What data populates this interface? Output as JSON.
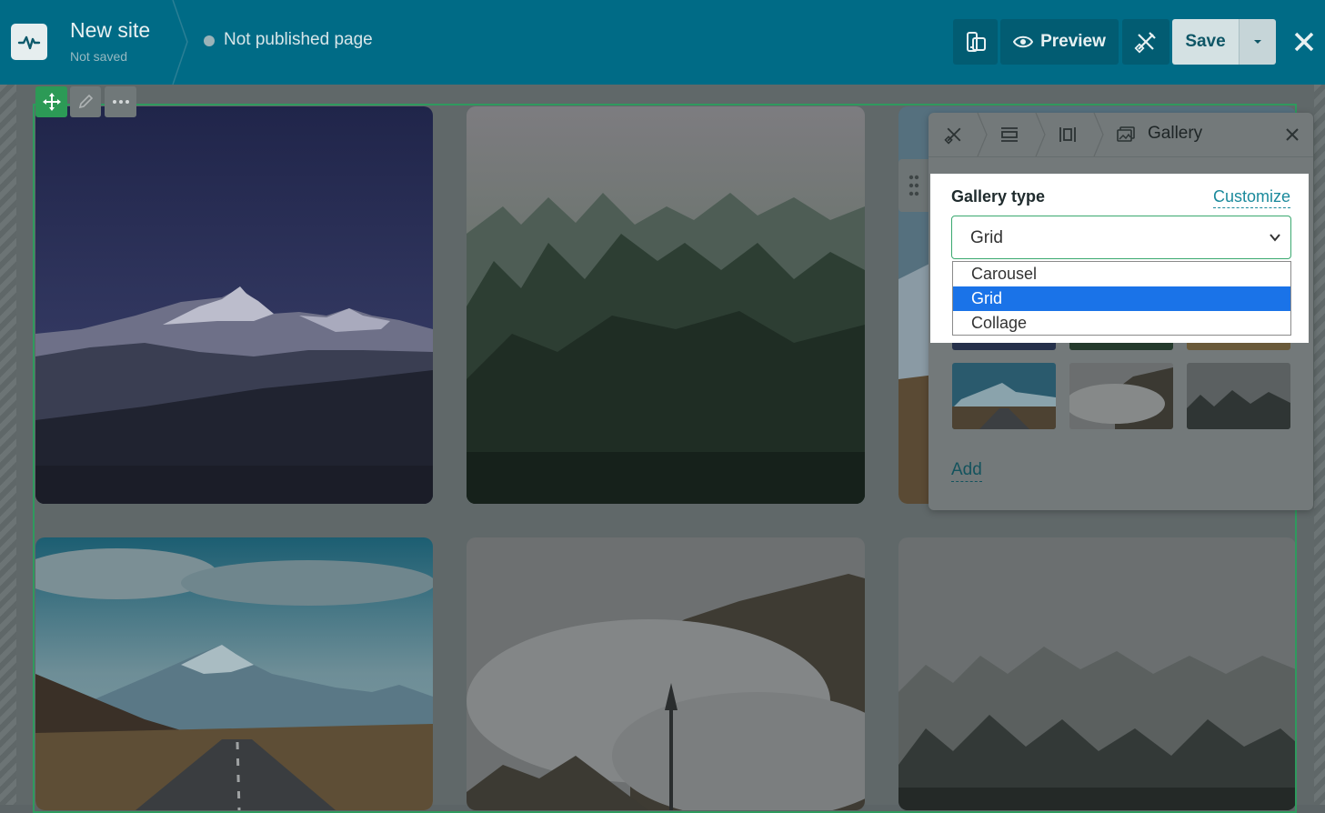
{
  "header": {
    "site_title": "New site",
    "site_subtitle": "Not saved",
    "page_status": "Not published page",
    "preview_label": "Preview",
    "save_label": "Save"
  },
  "panel": {
    "breadcrumb_current": "Gallery",
    "gallery_type_label": "Gallery type",
    "customize_label": "Customize",
    "selected_type": "Grid",
    "options": [
      "Carousel",
      "Grid",
      "Collage"
    ],
    "add_label": "Add"
  },
  "colors": {
    "topbar": "#006b86",
    "accent_green": "#2c9a56",
    "link": "#1b8a9c",
    "option_selected": "#1a73e8"
  },
  "icons": [
    "pulse-logo-icon",
    "responsive-icon",
    "eye-icon",
    "design-tools-icon",
    "chevron-down-icon",
    "close-icon",
    "move-icon",
    "pencil-icon",
    "more-icon",
    "drag-handle-icon",
    "section-icon",
    "columns-icon",
    "gallery-image-icon"
  ]
}
